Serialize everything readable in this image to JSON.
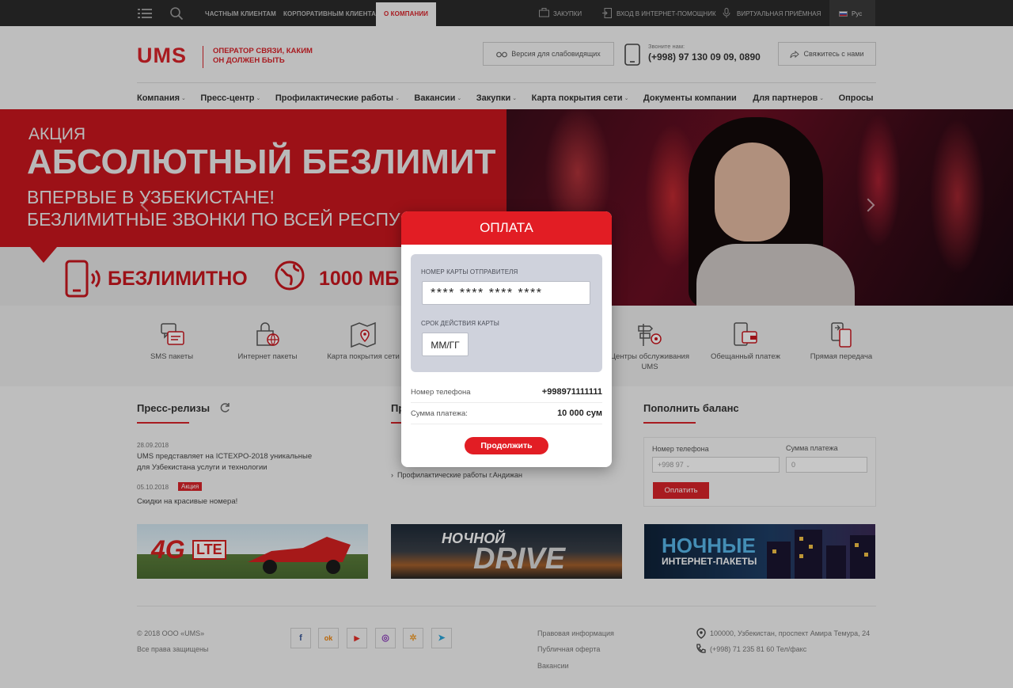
{
  "topbar": {
    "segments": [
      "Частным клиентам",
      "Корпоративным клиентам",
      "О компании"
    ],
    "right_items": [
      "Закупки",
      "Вход в интернет-помощник",
      "Виртуальная приёмная"
    ],
    "language": "Рус",
    "icons": [
      "menu-icon",
      "search-icon",
      "briefcase-icon",
      "login-icon",
      "microphone-icon",
      "flag-icon"
    ]
  },
  "header": {
    "logo": "UMS",
    "tagline": "ОПЕРАТОР СВЯЗИ, КАКИМ ОН ДОЛЖЕН БЫТЬ",
    "low_vision_btn": "Версия для слабовидящих",
    "call_label": "Звоните нам:",
    "call_number": "(+998) 97 130 09 09, 0890",
    "contact_btn": "Свяжитесь с нами"
  },
  "nav": {
    "items": [
      {
        "label": "Компания",
        "chevron": "⌄"
      },
      {
        "label": "Пресс-центр",
        "chevron": "⌄"
      },
      {
        "label": "Профилактические работы",
        "chevron": "⌄"
      },
      {
        "label": "Вакансии",
        "chevron": "⌄"
      },
      {
        "label": "Закупки",
        "chevron": "⌄"
      },
      {
        "label": "Карта покрытия сети",
        "chevron": "⌄"
      },
      {
        "label": "Документы компании",
        "chevron": ""
      },
      {
        "label": "Для партнеров",
        "chevron": "⌄"
      },
      {
        "label": "Опросы",
        "chevron": ""
      }
    ]
  },
  "hero": {
    "small": "Акция",
    "big": "Абсолютный безлимит",
    "line1": "Впервые в Узбекистане!",
    "line2": "Безлимитные звонки  по всей респу",
    "feature1": "БЕЗЛИМИТНО",
    "feature2": "1000 МБ"
  },
  "quick": {
    "items": [
      "SMS пакеты",
      "Интернет пакеты",
      "Карта покрытия сети",
      "Центры обслуживания UMS",
      "Обещанный платеж",
      "Прямая передача"
    ]
  },
  "press": {
    "title": "Пресс-релизы",
    "items": [
      {
        "date": "28.09.2018",
        "text": "UMS представляет на ICTEXPO-2018 уникальные для Узбекистана услуги и технологии",
        "tag": ""
      },
      {
        "date": "05.10.2018",
        "text": "Скидки на красивые номера!",
        "tag": "Акция"
      }
    ]
  },
  "middle": {
    "title": "Пр",
    "link_last": "Профилактические работы г.Андижан"
  },
  "balance": {
    "title": "Пополнить баланс",
    "phone_label": "Номер телефона",
    "phone_placeholder": "+998 97",
    "amount_label": "Сумма платежа",
    "amount_placeholder": "0",
    "pay_btn": "Оплатить"
  },
  "banners": {
    "b1_text": "4G",
    "b1_sub": "LTE",
    "b2_top": "НОЧНОЙ",
    "b2_main": "DRIVE",
    "b3_top": "НОЧНЫЕ",
    "b3_sub": "ИНТЕРНЕТ-ПАКЕТЫ"
  },
  "footer": {
    "copyright": "© 2018 ООО «UMS»",
    "rights": "Все права защищены",
    "links": [
      "Правовая информация",
      "Публичная оферта",
      "Вакансии"
    ],
    "address": "100000, Узбекистан, проспект Амира Темура, 24",
    "phone": "(+998) 71 235 81 60 Тел/факс",
    "social": [
      "f",
      "ok",
      "▶",
      "◎",
      "✲",
      "➤"
    ]
  },
  "modal": {
    "title": "ОПЛАТА",
    "card_number_label": "Номер карты отправителя",
    "card_number_value": "**** **** **** ****",
    "expiry_label": "Срок действия карты",
    "expiry_value": "ММ/ГГ",
    "phone_label": "Номер телефона",
    "phone_value": "+998971111111",
    "amount_label": "Сумма платежа:",
    "amount_value": "10 000 сум",
    "continue_btn": "Продолжить"
  },
  "colors": {
    "brand": "#d8232a",
    "modal_header": "#e21d24",
    "topbar": "#2b2b2b"
  }
}
